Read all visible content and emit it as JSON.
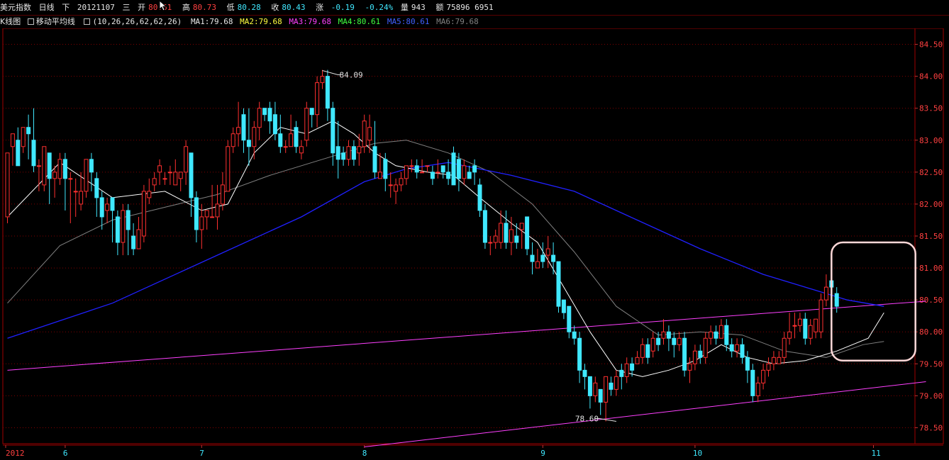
{
  "header": {
    "instrument": "美元指数",
    "period": "日线",
    "direction": "下",
    "date": "20121107",
    "weekday": "三",
    "open_label": "开",
    "open_value": "80.61",
    "high_label": "高",
    "high_value": "80.73",
    "low_label": "低",
    "low_value": "80.28",
    "close_label": "收",
    "close_value": "80.43",
    "change_label": "涨",
    "change_value": "-0.19",
    "change_pct": "-0.24%",
    "volume_label": "量",
    "volume_value": "943",
    "amount_label": "额",
    "amount_value": "75896 6951"
  },
  "indicator_bar": {
    "kline_label": "K线图",
    "ma_label": "移动平均线",
    "ma_params": "(10,26,26,62,62,26)",
    "ma1": "MA1:79.68",
    "ma2": "MA2:79.68",
    "ma3": "MA3:79.68",
    "ma4": "MA4:80.61",
    "ma5": "MA5:80.61",
    "ma6": "MA6:79.68"
  },
  "colors": {
    "up_candle": "#ff3030",
    "down_candle": "#40e8ff",
    "ma_short": "#ffffff",
    "ma_mid": "#808080",
    "ma_long": "#2020ff",
    "trendline": "#ff40ff",
    "grid": "#800000",
    "highlight_box": "#ffd8d8"
  },
  "chart_data": {
    "type": "candlestick",
    "ylim": [
      78.25,
      84.75
    ],
    "y_ticks": [
      "84.50",
      "84.00",
      "83.50",
      "83.00",
      "82.50",
      "82.00",
      "81.50",
      "81.00",
      "80.50",
      "80.00",
      "79.50",
      "79.00",
      "78.50"
    ],
    "x_labels": [
      {
        "label": "2012",
        "index": 0
      },
      {
        "label": "6",
        "index": 11
      },
      {
        "label": "7",
        "index": 37
      },
      {
        "label": "8",
        "index": 68
      },
      {
        "label": "9",
        "index": 102
      },
      {
        "label": "10",
        "index": 131
      },
      {
        "label": "11",
        "index": 165
      }
    ],
    "annotations": [
      {
        "text": "84.09",
        "index": 60,
        "value": 84.09,
        "type": "high"
      },
      {
        "text": "78.60",
        "index": 116,
        "value": 78.6,
        "type": "low"
      }
    ],
    "candles": [
      [
        81.8,
        82.8,
        82.4,
        81.7
      ],
      [
        82.9,
        83.1,
        82.6,
        83.0
      ],
      [
        83.0,
        82.6,
        82.8,
        83.2
      ],
      [
        82.9,
        83.2,
        82.8,
        83.2
      ],
      [
        83.2,
        83.1,
        82.7,
        83.4
      ],
      [
        83.0,
        82.6,
        82.5,
        83.5
      ],
      [
        82.6,
        82.6,
        82.2,
        82.7
      ],
      [
        82.3,
        82.9,
        82.2,
        82.9
      ],
      [
        82.8,
        82.4,
        82.0,
        82.8
      ],
      [
        82.4,
        82.5,
        82.1,
        82.6
      ],
      [
        82.4,
        82.7,
        82.3,
        82.8
      ],
      [
        82.7,
        82.4,
        81.9,
        82.8
      ],
      [
        82.4,
        82.4,
        81.7,
        82.5
      ],
      [
        82.2,
        82.2,
        81.8,
        82.4
      ],
      [
        82.0,
        82.2,
        81.9,
        82.5
      ],
      [
        82.2,
        82.7,
        82.1,
        82.7
      ],
      [
        82.7,
        82.5,
        82.2,
        82.8
      ],
      [
        82.4,
        82.1,
        81.8,
        82.5
      ],
      [
        82.1,
        81.8,
        81.6,
        82.2
      ],
      [
        81.9,
        82.0,
        81.7,
        82.1
      ],
      [
        82.1,
        81.9,
        81.4,
        82.1
      ],
      [
        81.8,
        81.4,
        81.2,
        81.9
      ],
      [
        81.4,
        81.9,
        81.2,
        82.0
      ],
      [
        81.9,
        81.6,
        81.2,
        82.0
      ],
      [
        81.5,
        81.3,
        81.2,
        81.7
      ],
      [
        81.3,
        81.6,
        81.3,
        81.8
      ],
      [
        81.5,
        82.2,
        81.4,
        82.3
      ],
      [
        82.1,
        82.2,
        82.0,
        82.4
      ],
      [
        82.3,
        82.4,
        82.2,
        82.5
      ],
      [
        82.5,
        82.6,
        82.3,
        82.7
      ],
      [
        82.4,
        82.4,
        82.3,
        82.5
      ],
      [
        82.5,
        82.5,
        82.3,
        82.6
      ],
      [
        82.3,
        82.5,
        82.3,
        82.7
      ],
      [
        82.4,
        82.5,
        82.2,
        82.5
      ],
      [
        82.5,
        82.9,
        82.3,
        83.0
      ],
      [
        82.8,
        82.1,
        81.8,
        82.8
      ],
      [
        82.1,
        81.6,
        81.4,
        82.2
      ],
      [
        81.6,
        81.8,
        81.3,
        82.0
      ],
      [
        81.8,
        81.9,
        81.6,
        81.9
      ],
      [
        81.8,
        81.8,
        81.8,
        82.3
      ],
      [
        81.8,
        82.0,
        81.6,
        82.3
      ],
      [
        82.0,
        82.3,
        81.9,
        82.5
      ],
      [
        82.2,
        82.9,
        82.2,
        83.0
      ],
      [
        82.9,
        83.1,
        82.8,
        83.2
      ],
      [
        83.1,
        83.2,
        82.9,
        83.6
      ],
      [
        83.4,
        83.0,
        82.8,
        83.5
      ],
      [
        83.0,
        82.9,
        82.6,
        83.5
      ],
      [
        82.9,
        83.2,
        82.7,
        83.3
      ],
      [
        83.2,
        83.5,
        83.0,
        83.6
      ],
      [
        83.5,
        83.4,
        83.3,
        83.5
      ],
      [
        83.5,
        83.3,
        83.1,
        83.6
      ],
      [
        83.4,
        83.1,
        83.0,
        83.6
      ],
      [
        83.1,
        82.9,
        82.8,
        83.4
      ],
      [
        82.9,
        82.9,
        82.8,
        83.0
      ],
      [
        82.9,
        83.1,
        82.9,
        83.4
      ],
      [
        83.2,
        82.9,
        82.8,
        83.3
      ],
      [
        82.8,
        82.9,
        82.7,
        83.0
      ],
      [
        83.0,
        83.5,
        82.9,
        83.6
      ],
      [
        83.5,
        83.4,
        83.2,
        83.5
      ],
      [
        83.4,
        83.9,
        83.2,
        84.0
      ],
      [
        83.9,
        84.0,
        83.8,
        84.1
      ],
      [
        84.0,
        83.5,
        83.3,
        84.1
      ],
      [
        83.5,
        82.8,
        82.6,
        83.6
      ],
      [
        82.9,
        82.7,
        82.4,
        83.3
      ],
      [
        82.8,
        82.7,
        82.6,
        82.9
      ],
      [
        82.7,
        82.9,
        82.6,
        83.0
      ],
      [
        82.9,
        82.7,
        82.6,
        83.0
      ],
      [
        82.8,
        82.9,
        82.6,
        83.1
      ],
      [
        82.9,
        83.3,
        82.8,
        83.4
      ],
      [
        83.0,
        83.2,
        82.8,
        83.4
      ],
      [
        82.9,
        82.5,
        82.4,
        83.3
      ],
      [
        82.4,
        82.5,
        82.4,
        82.8
      ],
      [
        82.7,
        82.4,
        82.2,
        82.8
      ],
      [
        82.3,
        82.3,
        82.1,
        82.5
      ],
      [
        82.2,
        82.3,
        82.0,
        82.4
      ],
      [
        82.3,
        82.4,
        82.2,
        82.5
      ],
      [
        82.4,
        82.6,
        82.3,
        82.6
      ],
      [
        82.6,
        82.6,
        82.5,
        82.7
      ],
      [
        82.6,
        82.5,
        82.4,
        82.7
      ],
      [
        82.5,
        82.5,
        82.5,
        82.7
      ],
      [
        82.6,
        82.6,
        82.5,
        82.6
      ],
      [
        82.5,
        82.4,
        82.3,
        82.6
      ],
      [
        82.5,
        82.5,
        82.4,
        82.7
      ],
      [
        82.6,
        82.5,
        82.4,
        82.6
      ],
      [
        82.5,
        82.4,
        82.3,
        82.7
      ],
      [
        82.8,
        82.3,
        82.3,
        82.9
      ],
      [
        82.7,
        82.4,
        82.2,
        82.8
      ],
      [
        82.4,
        82.6,
        82.3,
        82.7
      ],
      [
        82.5,
        82.4,
        82.4,
        82.6
      ],
      [
        82.6,
        82.5,
        82.3,
        82.7
      ],
      [
        82.3,
        81.9,
        81.8,
        82.4
      ],
      [
        81.9,
        81.4,
        81.3,
        82.0
      ],
      [
        81.4,
        81.4,
        81.2,
        81.5
      ],
      [
        81.4,
        81.5,
        81.3,
        81.6
      ],
      [
        81.4,
        81.7,
        81.3,
        81.9
      ],
      [
        81.7,
        81.4,
        81.3,
        81.9
      ],
      [
        81.4,
        81.6,
        81.2,
        81.8
      ],
      [
        81.5,
        81.4,
        81.3,
        81.7
      ],
      [
        81.6,
        81.7,
        81.3,
        81.7
      ],
      [
        81.8,
        81.3,
        81.2,
        81.8
      ],
      [
        81.2,
        81.1,
        80.9,
        81.4
      ],
      [
        81.0,
        81.1,
        81.0,
        81.3
      ],
      [
        81.2,
        81.1,
        81.0,
        81.4
      ],
      [
        81.2,
        81.3,
        81.0,
        81.5
      ],
      [
        81.2,
        81.1,
        80.9,
        81.4
      ],
      [
        81.1,
        80.4,
        80.3,
        81.1
      ],
      [
        80.5,
        80.3,
        80.2,
        80.5
      ],
      [
        80.4,
        80.0,
        79.9,
        80.4
      ],
      [
        80.0,
        79.9,
        79.8,
        80.1
      ],
      [
        79.9,
        79.4,
        79.2,
        80.0
      ],
      [
        79.4,
        79.3,
        79.1,
        79.5
      ],
      [
        79.3,
        79.0,
        78.8,
        79.3
      ],
      [
        79.0,
        79.2,
        78.9,
        79.3
      ],
      [
        79.1,
        78.9,
        78.7,
        79.1
      ],
      [
        78.9,
        79.3,
        78.6,
        79.3
      ],
      [
        79.2,
        79.1,
        79.0,
        79.3
      ],
      [
        79.1,
        79.3,
        79.0,
        79.4
      ],
      [
        79.4,
        79.3,
        79.1,
        79.5
      ],
      [
        79.3,
        79.5,
        79.2,
        79.6
      ],
      [
        79.5,
        79.4,
        79.3,
        79.6
      ],
      [
        79.5,
        79.6,
        79.5,
        79.7
      ],
      [
        79.6,
        79.8,
        79.5,
        79.9
      ],
      [
        79.8,
        79.6,
        79.5,
        79.9
      ],
      [
        79.7,
        79.9,
        79.6,
        80.0
      ],
      [
        79.9,
        79.8,
        79.7,
        80.0
      ],
      [
        79.9,
        80.0,
        79.8,
        80.2
      ],
      [
        80.0,
        79.9,
        79.7,
        80.1
      ],
      [
        79.9,
        79.8,
        79.6,
        80.0
      ],
      [
        79.8,
        79.9,
        79.7,
        80.0
      ],
      [
        79.9,
        79.4,
        79.3,
        80.0
      ],
      [
        79.4,
        79.5,
        79.2,
        79.6
      ],
      [
        79.5,
        79.7,
        79.4,
        79.8
      ],
      [
        79.7,
        79.6,
        79.5,
        79.8
      ],
      [
        79.6,
        79.9,
        79.5,
        80.0
      ],
      [
        79.9,
        80.0,
        79.8,
        80.1
      ],
      [
        80.0,
        79.9,
        79.8,
        80.1
      ],
      [
        79.9,
        80.1,
        79.9,
        80.2
      ],
      [
        80.1,
        79.8,
        79.7,
        80.2
      ],
      [
        79.8,
        79.7,
        79.6,
        79.9
      ],
      [
        79.7,
        79.8,
        79.6,
        79.9
      ],
      [
        79.8,
        79.6,
        79.5,
        79.9
      ],
      [
        79.6,
        79.4,
        79.2,
        79.7
      ],
      [
        79.4,
        79.0,
        78.9,
        79.5
      ],
      [
        79.0,
        79.2,
        78.9,
        79.3
      ],
      [
        79.2,
        79.4,
        79.1,
        79.5
      ],
      [
        79.4,
        79.5,
        79.3,
        79.6
      ],
      [
        79.5,
        79.6,
        79.4,
        79.7
      ],
      [
        79.5,
        79.6,
        79.5,
        79.7
      ],
      [
        79.6,
        79.9,
        79.5,
        80.0
      ],
      [
        79.9,
        80.0,
        79.8,
        80.3
      ],
      [
        80.1,
        80.1,
        79.9,
        80.3
      ],
      [
        80.1,
        80.2,
        80.0,
        80.3
      ],
      [
        80.2,
        79.9,
        79.8,
        80.3
      ],
      [
        79.9,
        80.1,
        79.8,
        80.2
      ],
      [
        80.0,
        80.2,
        79.9,
        80.2
      ],
      [
        80.0,
        80.5,
        79.9,
        80.6
      ],
      [
        80.5,
        80.7,
        80.4,
        80.9
      ],
      [
        80.8,
        80.7,
        80.6,
        80.9
      ],
      [
        80.6,
        80.4,
        80.3,
        80.7
      ]
    ],
    "ma_short": [
      [
        0,
        81.8
      ],
      [
        10,
        82.65
      ],
      [
        20,
        82.1
      ],
      [
        30,
        82.2
      ],
      [
        37,
        81.9
      ],
      [
        42,
        82.0
      ],
      [
        47,
        82.8
      ],
      [
        52,
        83.2
      ],
      [
        57,
        83.1
      ],
      [
        62,
        83.3
      ],
      [
        66,
        83.1
      ],
      [
        70,
        82.8
      ],
      [
        74,
        82.6
      ],
      [
        80,
        82.5
      ],
      [
        85,
        82.45
      ],
      [
        90,
        82.1
      ],
      [
        96,
        81.7
      ],
      [
        101,
        81.4
      ],
      [
        106,
        80.7
      ],
      [
        111,
        80.0
      ],
      [
        116,
        79.4
      ],
      [
        121,
        79.3
      ],
      [
        126,
        79.4
      ],
      [
        131,
        79.55
      ],
      [
        136,
        79.8
      ],
      [
        141,
        79.6
      ],
      [
        146,
        79.5
      ],
      [
        152,
        79.55
      ],
      [
        158,
        79.7
      ],
      [
        164,
        79.9
      ],
      [
        167,
        80.3
      ]
    ],
    "ma_mid": [
      [
        0,
        80.45
      ],
      [
        10,
        81.35
      ],
      [
        20,
        81.75
      ],
      [
        30,
        81.95
      ],
      [
        40,
        82.15
      ],
      [
        50,
        82.45
      ],
      [
        60,
        82.7
      ],
      [
        70,
        82.95
      ],
      [
        76,
        83.0
      ],
      [
        84,
        82.8
      ],
      [
        92,
        82.5
      ],
      [
        100,
        82.0
      ],
      [
        108,
        81.25
      ],
      [
        116,
        80.4
      ],
      [
        124,
        79.95
      ],
      [
        132,
        80.0
      ],
      [
        140,
        79.95
      ],
      [
        148,
        79.7
      ],
      [
        156,
        79.6
      ],
      [
        163,
        79.8
      ],
      [
        167,
        79.85
      ]
    ],
    "ma_long": [
      [
        0,
        79.9
      ],
      [
        20,
        80.45
      ],
      [
        40,
        81.2
      ],
      [
        56,
        81.8
      ],
      [
        68,
        82.35
      ],
      [
        76,
        82.55
      ],
      [
        84,
        82.65
      ],
      [
        96,
        82.45
      ],
      [
        108,
        82.2
      ],
      [
        120,
        81.75
      ],
      [
        132,
        81.3
      ],
      [
        144,
        80.9
      ],
      [
        152,
        80.7
      ],
      [
        160,
        80.5
      ],
      [
        167,
        80.4
      ]
    ],
    "trendlines": [
      {
        "from": [
          0,
          79.4
        ],
        "to": [
          175,
          80.48
        ]
      },
      {
        "from": [
          68,
          78.2
        ],
        "to": [
          175,
          79.22
        ]
      }
    ],
    "highlight_box": {
      "from_index": 157,
      "to_index": 173,
      "top": 81.4,
      "bottom": 79.55
    }
  }
}
